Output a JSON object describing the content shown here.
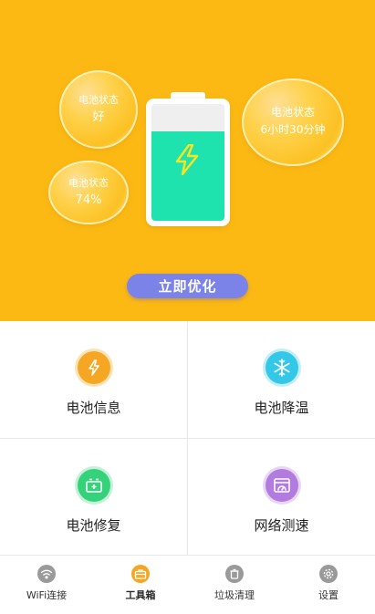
{
  "hero": {
    "bubbles": [
      {
        "label": "电池状态",
        "value": "好"
      },
      {
        "label": "电池状态",
        "value": "74%"
      },
      {
        "label": "电池状态",
        "value": "6小时30分钟"
      }
    ],
    "battery_level": 0.74,
    "optimize_label": "立即优化"
  },
  "tools": [
    {
      "label": "电池信息",
      "icon": "battery-bolt-icon",
      "color": "#F5A623"
    },
    {
      "label": "电池降温",
      "icon": "snowflake-icon",
      "color": "#33C7E8"
    },
    {
      "label": "电池修复",
      "icon": "battery-repair-icon",
      "color": "#34D27B"
    },
    {
      "label": "网络测速",
      "icon": "speedometer-icon",
      "color": "#B27BE0"
    }
  ],
  "tabbar": {
    "items": [
      {
        "label": "WiFi连接",
        "icon": "wifi-icon"
      },
      {
        "label": "工具箱",
        "icon": "toolbox-icon"
      },
      {
        "label": "垃圾清理",
        "icon": "trash-icon"
      },
      {
        "label": "设置",
        "icon": "gear-icon"
      }
    ],
    "active_index": 1
  },
  "colors": {
    "hero_bg": "#FDB913",
    "battery_fill": "#1EE3AF",
    "button": "#7B83E8",
    "active_tab": "#F5A623"
  }
}
